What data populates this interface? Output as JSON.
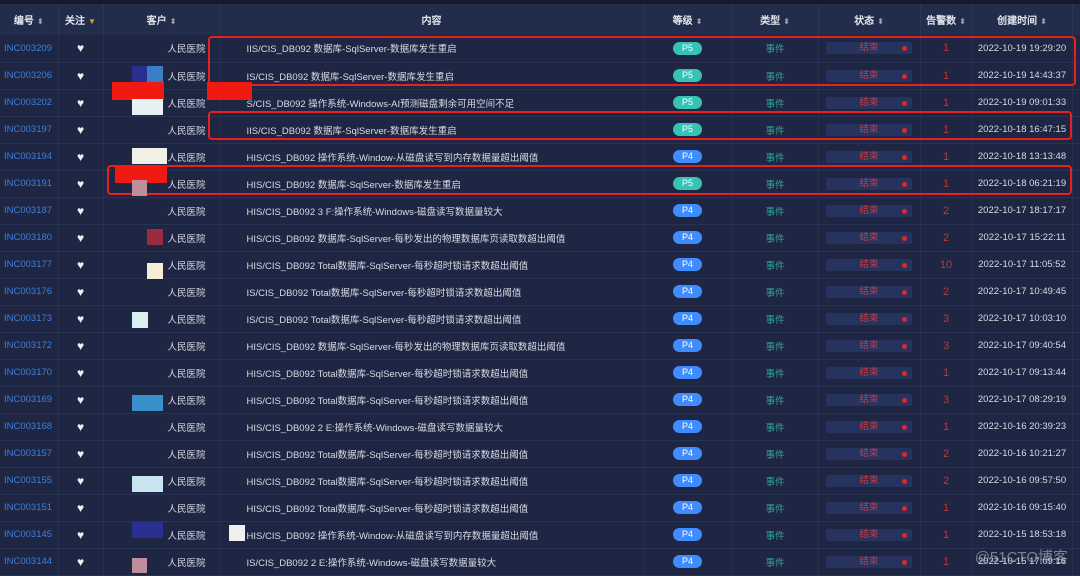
{
  "columns": [
    {
      "label": "编号",
      "sort": "both"
    },
    {
      "label": "关注",
      "sort": "desc"
    },
    {
      "label": "客户",
      "sort": "both"
    },
    {
      "label": "内容",
      "sort": ""
    },
    {
      "label": "等级",
      "sort": "both"
    },
    {
      "label": "类型",
      "sort": "both"
    },
    {
      "label": "状态",
      "sort": "both"
    },
    {
      "label": "告警数",
      "sort": "both"
    },
    {
      "label": "创建时间",
      "sort": "both"
    }
  ],
  "colors": {
    "P5": "#36c2b4",
    "P4": "#3f8cff"
  },
  "rows": [
    {
      "id": "INC003209",
      "customer": "人民医院",
      "content": "IIS/CIS_DB092 数据库-SqlServer-数据库发生重启",
      "level": "P5",
      "type": "事件",
      "status": "结束",
      "count": "1",
      "time": "2022-10-19 19:29:20"
    },
    {
      "id": "INC003206",
      "customer": "人民医院",
      "content": "IS/CIS_DB092 数据库-SqlServer-数据库发生重启",
      "level": "P5",
      "type": "事件",
      "status": "结束",
      "count": "1",
      "time": "2022-10-19 14:43:37"
    },
    {
      "id": "INC003202",
      "customer": "人民医院",
      "content": "S/CIS_DB092 操作系统-Windows-AI预测磁盘剩余可用空间不足",
      "level": "P5",
      "type": "事件",
      "status": "结束",
      "count": "1",
      "time": "2022-10-19 09:01:33"
    },
    {
      "id": "INC003197",
      "customer": "人民医院",
      "content": "IIS/CIS_DB092 数据库-SqlServer-数据库发生重启",
      "level": "P5",
      "type": "事件",
      "status": "结束",
      "count": "1",
      "time": "2022-10-18 16:47:15"
    },
    {
      "id": "INC003194",
      "customer": "人民医院",
      "content": "HIS/CIS_DB092 操作系统-Window-从磁盘读写到内存数据量超出阈值",
      "level": "P4",
      "type": "事件",
      "status": "结束",
      "count": "1",
      "time": "2022-10-18 13:13:48"
    },
    {
      "id": "INC003191",
      "customer": "人民医院",
      "content": "HIS/CIS_DB092 数据库-SqlServer-数据库发生重启",
      "level": "P5",
      "type": "事件",
      "status": "结束",
      "count": "1",
      "time": "2022-10-18 06:21:19"
    },
    {
      "id": "INC003187",
      "customer": "人民医院",
      "content": "HIS/CIS_DB092 3 F:操作系统-Windows-磁盘读写数据量较大",
      "level": "P4",
      "type": "事件",
      "status": "结束",
      "count": "2",
      "time": "2022-10-17 18:17:17"
    },
    {
      "id": "INC003180",
      "customer": "人民医院",
      "content": "HIS/CIS_DB092 数据库-SqlServer-每秒发出的物理数据库页读取数超出阈值",
      "level": "P4",
      "type": "事件",
      "status": "结束",
      "count": "2",
      "time": "2022-10-17 15:22:11"
    },
    {
      "id": "INC003177",
      "customer": "人民医院",
      "content": "HIS/CIS_DB092 Total数据库-SqlServer-每秒超时锁请求数超出阈值",
      "level": "P4",
      "type": "事件",
      "status": "结束",
      "count": "10",
      "time": "2022-10-17 11:05:52"
    },
    {
      "id": "INC003176",
      "customer": "人民医院",
      "content": "IS/CIS_DB092 Total数据库-SqlServer-每秒超时锁请求数超出阈值",
      "level": "P4",
      "type": "事件",
      "status": "结束",
      "count": "2",
      "time": "2022-10-17 10:49:45"
    },
    {
      "id": "INC003173",
      "customer": "人民医院",
      "content": "IS/CIS_DB092 Total数据库-SqlServer-每秒超时锁请求数超出阈值",
      "level": "P4",
      "type": "事件",
      "status": "结束",
      "count": "3",
      "time": "2022-10-17 10:03:10"
    },
    {
      "id": "INC003172",
      "customer": "人民医院",
      "content": "HIS/CIS_DB092 数据库-SqlServer-每秒发出的物理数据库页读取数超出阈值",
      "level": "P4",
      "type": "事件",
      "status": "结束",
      "count": "3",
      "time": "2022-10-17 09:40:54"
    },
    {
      "id": "INC003170",
      "customer": "人民医院",
      "content": "HIS/CIS_DB092 Total数据库-SqlServer-每秒超时锁请求数超出阈值",
      "level": "P4",
      "type": "事件",
      "status": "结束",
      "count": "1",
      "time": "2022-10-17 09:13:44"
    },
    {
      "id": "INC003169",
      "customer": "人民医院",
      "content": "HIS/CIS_DB092 Total数据库-SqlServer-每秒超时锁请求数超出阈值",
      "level": "P4",
      "type": "事件",
      "status": "结束",
      "count": "3",
      "time": "2022-10-17 08:29:19"
    },
    {
      "id": "INC003168",
      "customer": "人民医院",
      "content": "HIS/CIS_DB092 2 E:操作系统-Windows-磁盘读写数据量较大",
      "level": "P4",
      "type": "事件",
      "status": "结束",
      "count": "1",
      "time": "2022-10-16 20:39:23"
    },
    {
      "id": "INC003157",
      "customer": "人民医院",
      "content": "HIS/CIS_DB092 Total数据库-SqlServer-每秒超时锁请求数超出阈值",
      "level": "P4",
      "type": "事件",
      "status": "结束",
      "count": "2",
      "time": "2022-10-16 10:21:27"
    },
    {
      "id": "INC003155",
      "customer": "人民医院",
      "content": "HIS/CIS_DB092 Total数据库-SqlServer-每秒超时锁请求数超出阈值",
      "level": "P4",
      "type": "事件",
      "status": "结束",
      "count": "2",
      "time": "2022-10-16 09:57:50"
    },
    {
      "id": "INC003151",
      "customer": "人民医院",
      "content": "HIS/CIS_DB092 Total数据库-SqlServer-每秒超时锁请求数超出阈值",
      "level": "P4",
      "type": "事件",
      "status": "结束",
      "count": "1",
      "time": "2022-10-16 09:15:40"
    },
    {
      "id": "INC003145",
      "customer": "人民医院",
      "content": "HIS/CIS_DB092 操作系统-Window-从磁盘读写到内存数据量超出阈值",
      "level": "P4",
      "type": "事件",
      "status": "结束",
      "count": "1",
      "time": "2022-10-15 18:53:18"
    },
    {
      "id": "INC003144",
      "customer": "人民医院",
      "content": "IS/CIS_DB092 2 E:操作系统-Windows-磁盘读写数据量较大",
      "level": "P4",
      "type": "事件",
      "status": "结束",
      "count": "1",
      "time": "2022-10-15 17:09:16"
    }
  ],
  "watermark": "@51CTO博客"
}
